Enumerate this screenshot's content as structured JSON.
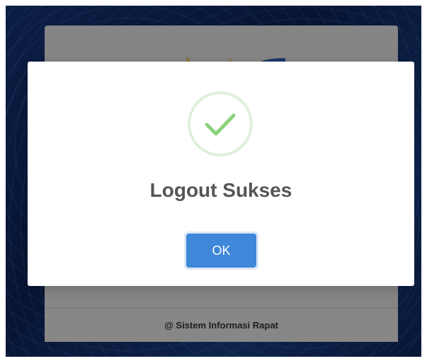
{
  "background": {
    "footer_text": "@ Sistem Informasi Rapat",
    "colors": {
      "pattern_base": "#0d2454",
      "card": "#c7c7c7"
    },
    "logo_icon": "partially-hidden-logo"
  },
  "modal": {
    "icon": "check-circle-icon",
    "title": "Logout Sukses",
    "ok_label": "OK",
    "colors": {
      "check": "#8bd17c",
      "ring": "#dff1d9",
      "button": "#3f87d8"
    }
  }
}
